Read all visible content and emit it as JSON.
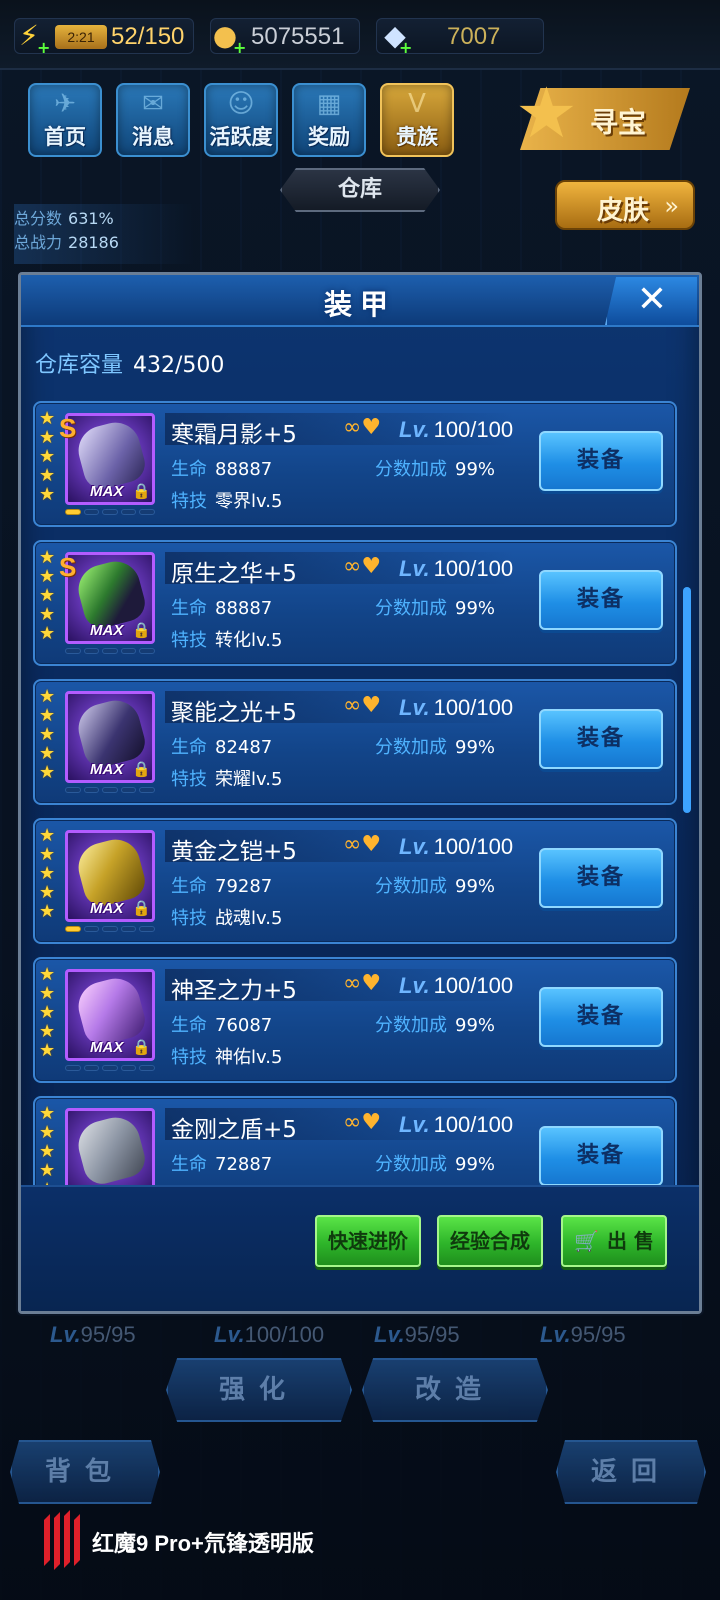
{
  "topbar": {
    "stamina_timer": "2:21",
    "stamina": "52/150",
    "gold": "5075551",
    "diamonds": "7007"
  },
  "nav": {
    "items": [
      {
        "label": "首页"
      },
      {
        "label": "消息"
      },
      {
        "label": "活跃度"
      },
      {
        "label": "奖励"
      },
      {
        "label": "贵族"
      }
    ],
    "treasure": "寻宝"
  },
  "warehouse_tab": "仓库",
  "skin_button": "皮肤",
  "stats": {
    "score_label": "总分数",
    "score_value": "631%",
    "power_label": "总战力",
    "power_value": "28186"
  },
  "modal": {
    "title": "装甲",
    "close": "✕",
    "capacity_label": "仓库容量",
    "capacity_value": "432/500",
    "hp_label": "生命",
    "bonus_label": "分数加成",
    "skill_label": "特技",
    "lv_prefix": "Lv.",
    "equip_label": "装备",
    "items": [
      {
        "name": "寒霜月影+5",
        "level": "100/100",
        "hp": "88887",
        "bonus": "99%",
        "skill": "零界lv.5",
        "stars": 5,
        "rank": "S",
        "max": "MAX",
        "pips": 1
      },
      {
        "name": "原生之华+5",
        "level": "100/100",
        "hp": "88887",
        "bonus": "99%",
        "skill": "转化lv.5",
        "stars": 5,
        "rank": "S",
        "max": "MAX",
        "pips": 0
      },
      {
        "name": "聚能之光+5",
        "level": "100/100",
        "hp": "82487",
        "bonus": "99%",
        "skill": "荣耀lv.5",
        "stars": 5,
        "rank": "",
        "max": "MAX",
        "pips": 0
      },
      {
        "name": "黄金之铠+5",
        "level": "100/100",
        "hp": "79287",
        "bonus": "99%",
        "skill": "战魂lv.5",
        "stars": 5,
        "rank": "",
        "max": "MAX",
        "pips": 1
      },
      {
        "name": "神圣之力+5",
        "level": "100/100",
        "hp": "76087",
        "bonus": "99%",
        "skill": "神佑lv.5",
        "stars": 5,
        "rank": "",
        "max": "MAX",
        "pips": 0
      },
      {
        "name": "金刚之盾+5",
        "level": "100/100",
        "hp": "72887",
        "bonus": "99%",
        "skill": "",
        "stars": 5,
        "rank": "",
        "max": "",
        "pips": 0
      }
    ],
    "actions": {
      "quick_advance": "快速进阶",
      "exp_merge": "经验合成",
      "sell": "出 售"
    }
  },
  "background": {
    "levels": [
      "95/95",
      "100/100",
      "95/95",
      "95/95"
    ],
    "enhance": "强化",
    "modify": "改造",
    "backpack": "背包",
    "back": "返回"
  },
  "branding": {
    "text": "红魔9 Pro+氘锋透明版"
  },
  "colors": {
    "modal_blue": "#0d3571",
    "equip_blue": "#1f8fe6",
    "action_green": "#2eb52a",
    "star_gold": "#ffd83a",
    "label_blue": "#4fb3ff"
  }
}
